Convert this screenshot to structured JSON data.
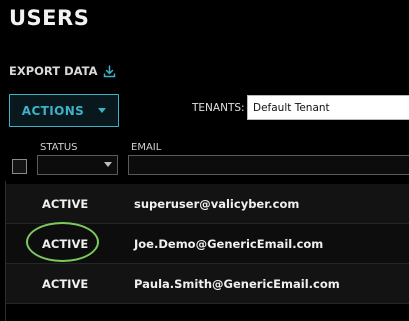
{
  "header": {
    "title": "USERS"
  },
  "toolbar": {
    "export_label": "EXPORT DATA",
    "actions_label": "ACTIONS",
    "tenants_label": "TENANTS:",
    "tenants_value": "Default Tenant"
  },
  "table": {
    "columns": [
      "STATUS",
      "EMAIL"
    ],
    "rows": [
      {
        "status": "ACTIVE",
        "email": "superuser@valicyber.com"
      },
      {
        "status": "ACTIVE",
        "email": "Joe.Demo@GenericEmail.com"
      },
      {
        "status": "ACTIVE",
        "email": "Paula.Smith@GenericEmail.com"
      }
    ]
  },
  "colors": {
    "accent": "#3eb1c8",
    "highlight": "#7dc95e",
    "background": "#000000"
  },
  "icons": {
    "export": "download-icon",
    "actions": "chevron-down-icon"
  }
}
